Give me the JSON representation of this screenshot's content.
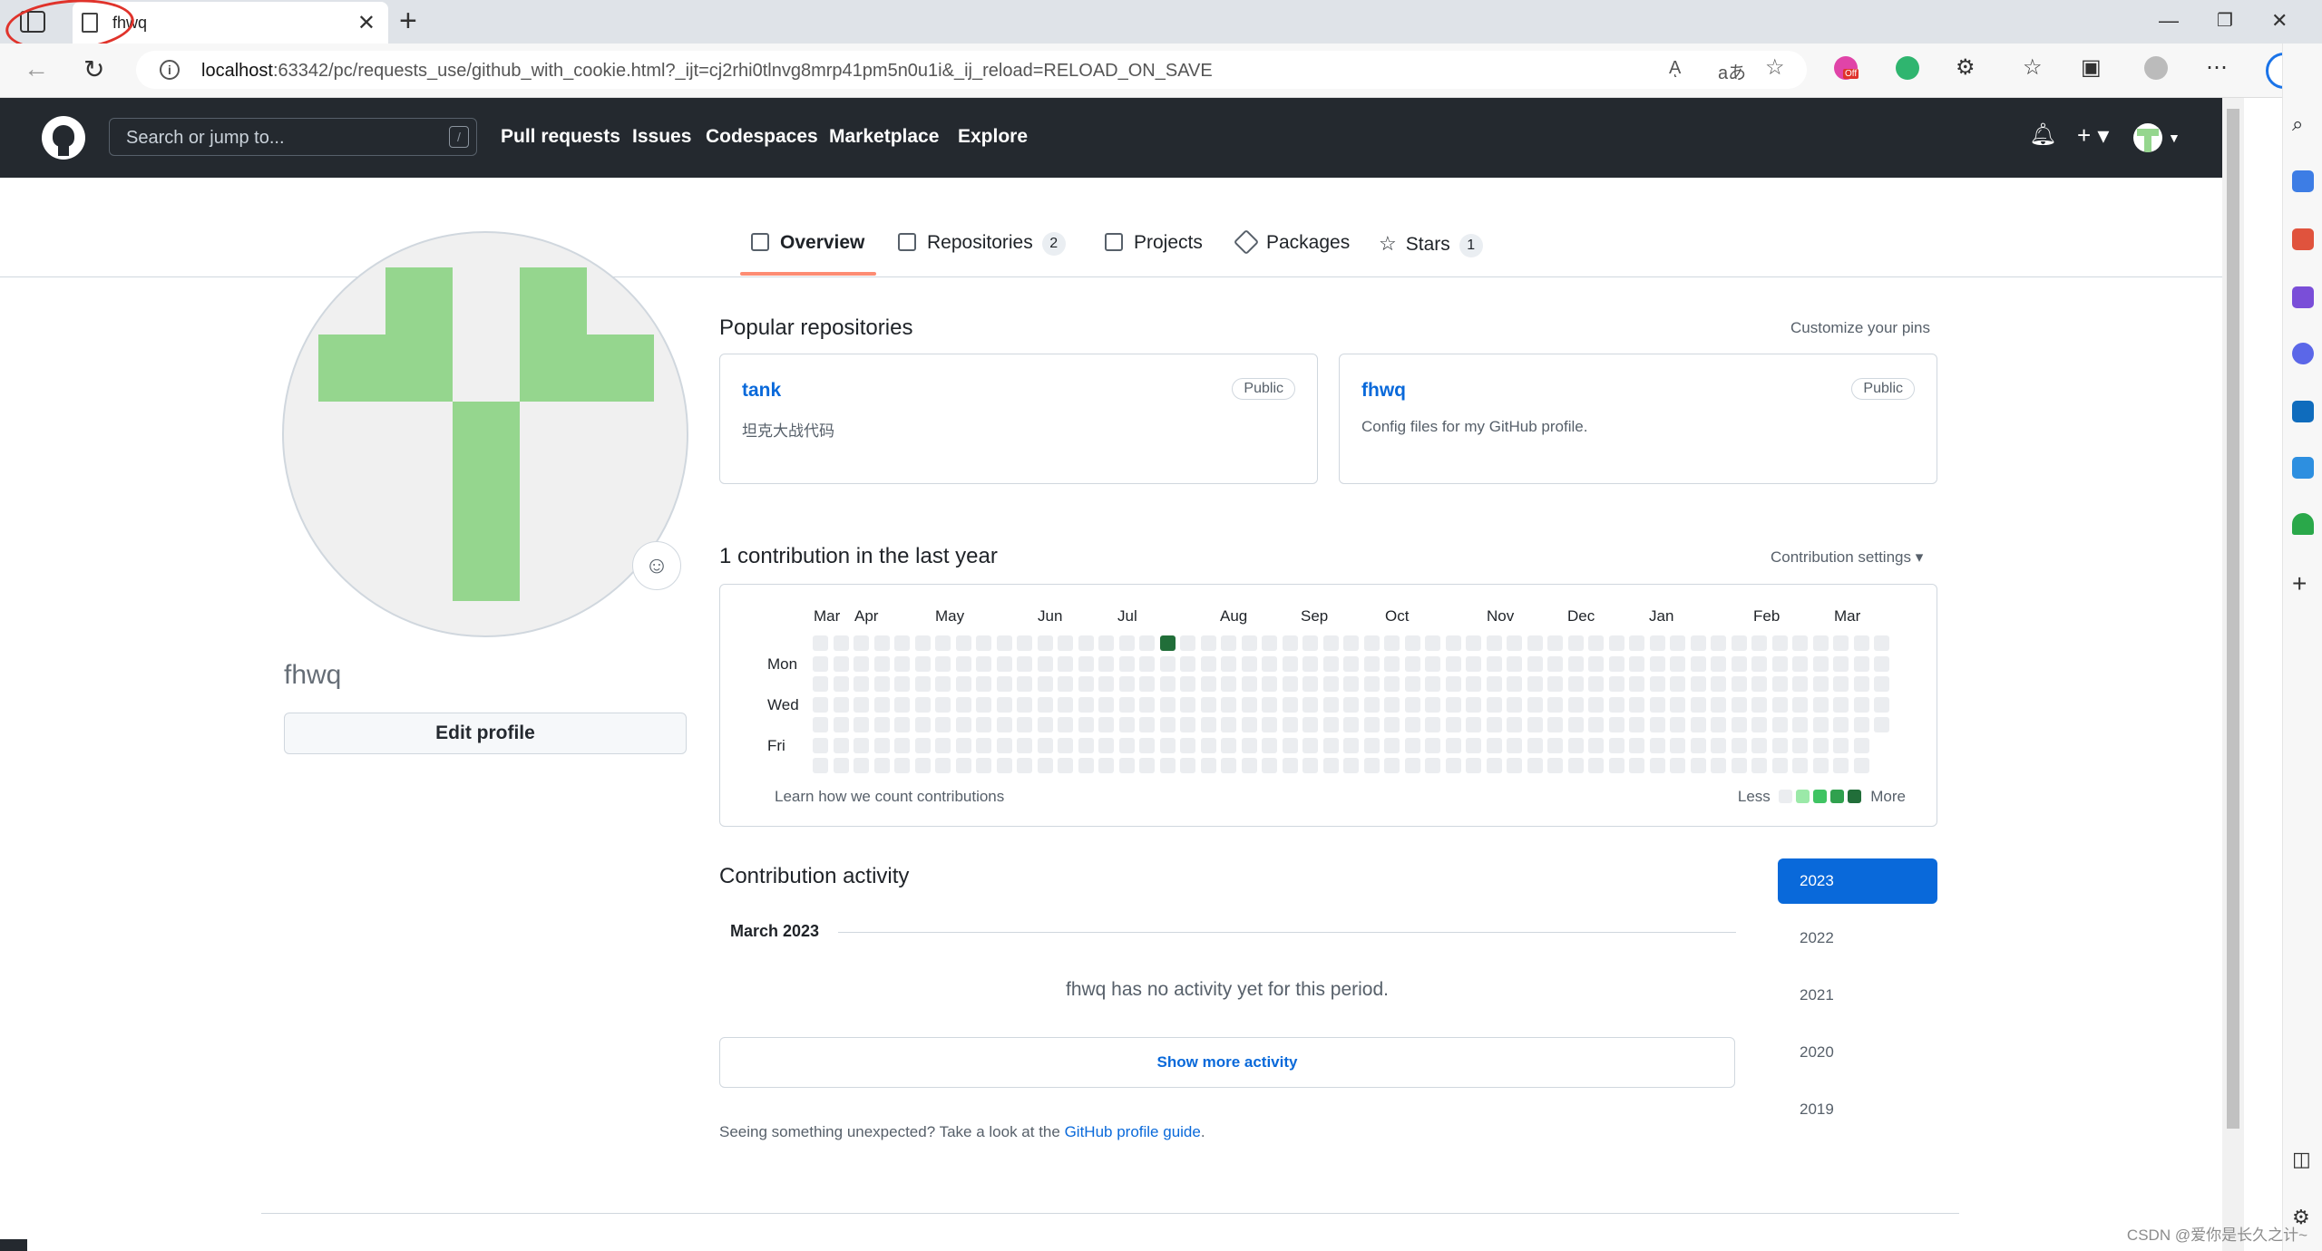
{
  "browser": {
    "tab_title": "fhwq",
    "url_host": "localhost",
    "url_rest": ":63342/pc/requests_use/github_with_cookie.html?_ijt=cj2rhi0tlnvg8mrp41pm5n0u1i&_ij_reload=RELOAD_ON_SAVE",
    "read_aloud_glyph": "Aͅ",
    "translate_glyph": "aあ",
    "ext_badge": "Off"
  },
  "header": {
    "search_placeholder": "Search or jump to...",
    "search_shortcut": "/",
    "nav": [
      "Pull requests",
      "Issues",
      "Codespaces",
      "Marketplace",
      "Explore"
    ]
  },
  "tabs": [
    {
      "label": "Overview",
      "icon": "book-icon"
    },
    {
      "label": "Repositories",
      "count": "2",
      "icon": "repo-icon"
    },
    {
      "label": "Projects",
      "icon": "table-icon"
    },
    {
      "label": "Packages",
      "icon": "package-icon"
    },
    {
      "label": "Stars",
      "count": "1",
      "icon": "star-icon"
    }
  ],
  "profile": {
    "username": "fhwq",
    "edit_label": "Edit profile"
  },
  "popular": {
    "title": "Popular repositories",
    "customize": "Customize your pins",
    "repos": [
      {
        "name": "tank",
        "visibility": "Public",
        "description": "坦克大战代码"
      },
      {
        "name": "fhwq",
        "visibility": "Public",
        "description": "Config files for my GitHub profile."
      }
    ]
  },
  "contributions": {
    "title": "1 contribution in the last year",
    "settings": "Contribution settings ▾",
    "months": [
      "Mar",
      "Apr",
      "May",
      "Jun",
      "Jul",
      "Aug",
      "Sep",
      "Oct",
      "Nov",
      "Dec",
      "Jan",
      "Feb",
      "Mar"
    ],
    "days": [
      "Mon",
      "Wed",
      "Fri"
    ],
    "learn": "Learn how we count contributions",
    "less": "Less",
    "more": "More",
    "weeks": 53,
    "contribution_cells": [
      {
        "week": 17,
        "day": 0,
        "level": 4
      }
    ],
    "colors": [
      "#ebedf0",
      "#9be9a8",
      "#40c463",
      "#30a14e",
      "#216e39"
    ]
  },
  "activity": {
    "title": "Contribution activity",
    "month": "March 2023",
    "empty": "fhwq has no activity yet for this period.",
    "show_more": "Show more activity",
    "note_prefix": "Seeing something unexpected? Take a look at the ",
    "note_link": "GitHub profile guide",
    "note_suffix": "."
  },
  "years": [
    "2023",
    "2022",
    "2021",
    "2020",
    "2019"
  ],
  "watermark": "CSDN @爱你是长久之计~"
}
